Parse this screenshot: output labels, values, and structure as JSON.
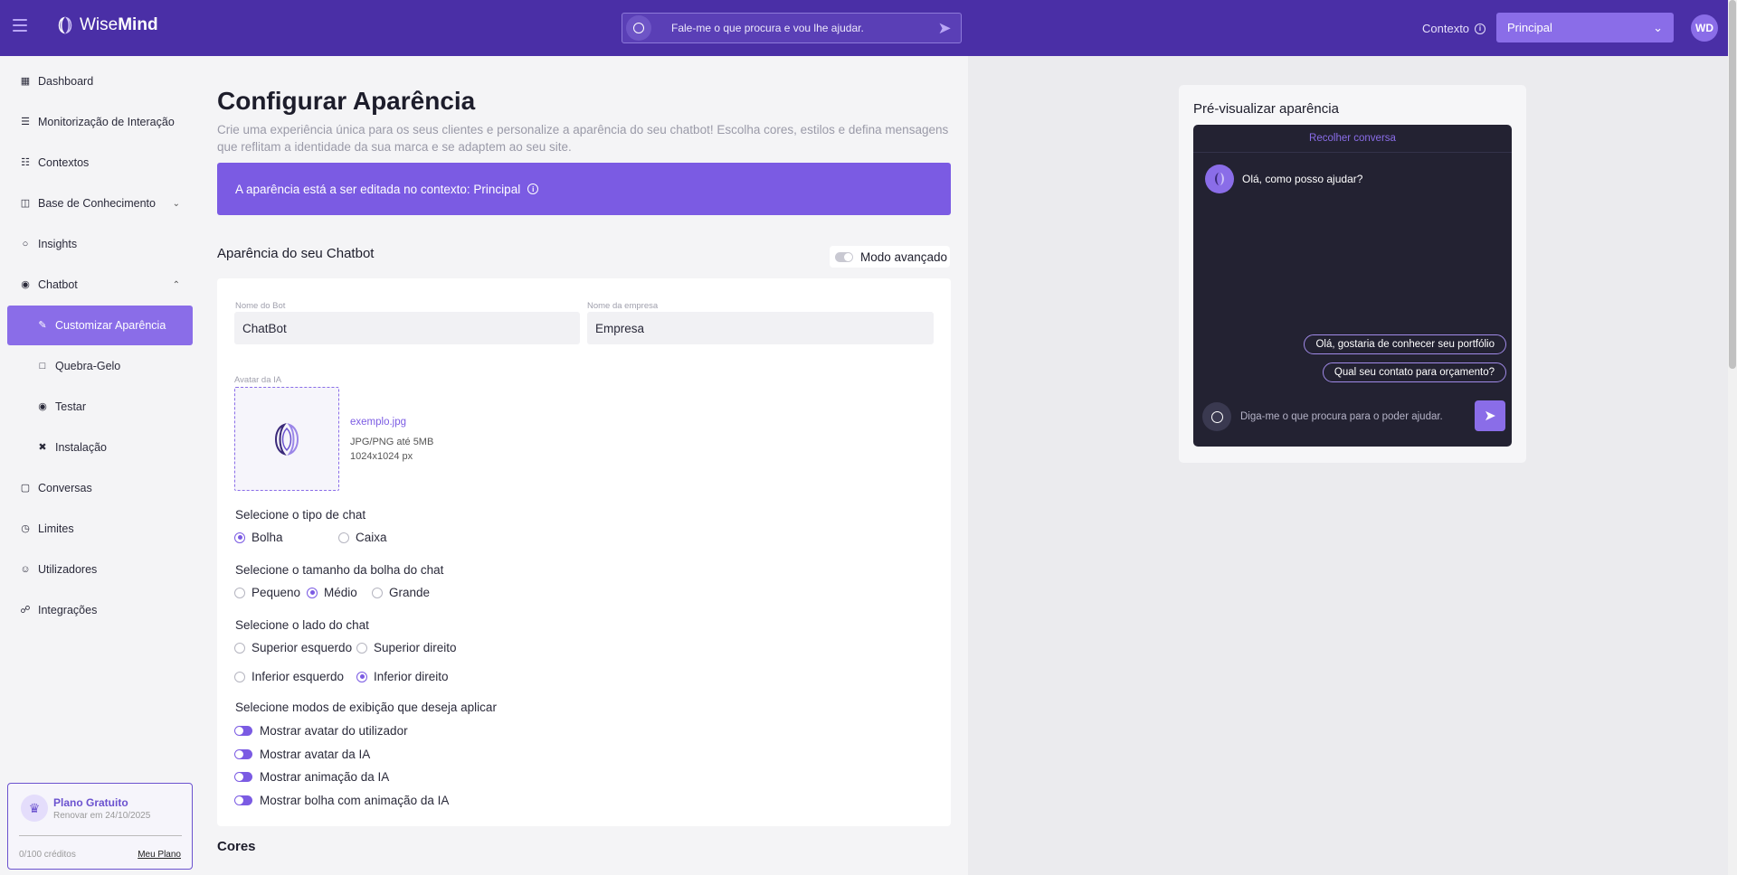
{
  "header": {
    "logo_wise": "Wise",
    "logo_mind": "Mind",
    "search_placeholder": "Fale-me o que procura e vou lhe ajudar.",
    "context_label": "Contexto",
    "context_value": "Principal",
    "user_initials": "WD"
  },
  "sidebar": {
    "items": [
      {
        "label": "Dashboard",
        "icon": "dashboard-icon"
      },
      {
        "label": "Monitorização de Interação",
        "icon": "monitor-icon"
      },
      {
        "label": "Contextos",
        "icon": "contexts-icon"
      },
      {
        "label": "Base de Conhecimento",
        "icon": "knowledge-icon"
      },
      {
        "label": "Insights",
        "icon": "lightbulb-icon"
      },
      {
        "label": "Chatbot",
        "icon": "chatbot-icon"
      },
      {
        "label": "Customizar Aparência",
        "icon": "edit-icon"
      },
      {
        "label": "Quebra-Gelo",
        "icon": "chat-bubble-icon"
      },
      {
        "label": "Testar",
        "icon": "eye-icon"
      },
      {
        "label": "Instalação",
        "icon": "tools-icon"
      },
      {
        "label": "Conversas",
        "icon": "conversations-icon"
      },
      {
        "label": "Limites",
        "icon": "timer-icon"
      },
      {
        "label": "Utilizadores",
        "icon": "user-icon"
      },
      {
        "label": "Integrações",
        "icon": "integrations-icon"
      }
    ],
    "plan": {
      "title": "Plano Gratuito",
      "renew": "Renovar em 24/10/2025",
      "credits": "0/100 créditos",
      "link": "Meu Plano"
    }
  },
  "main": {
    "title": "Configurar Aparência",
    "description": "Crie uma experiência única para os seus clientes e personalize a aparência do seu chatbot! Escolha cores, estilos e defina mensagens que reflitam a identidade da sua marca e se adaptem ao seu site.",
    "banner": "A aparência está a ser editada no contexto: Principal",
    "section_title": "Aparência do seu Chatbot",
    "advanced_mode": "Modo avançado",
    "bot_name_label": "Nome do Bot",
    "bot_name_value": "ChatBot",
    "company_label": "Nome da empresa",
    "company_value": "Empresa",
    "avatar_label": "Avatar da IA",
    "file_name": "exemplo.jpg",
    "file_types": "JPG/PNG até 5MB",
    "file_dims": "1024x1024 px",
    "chat_type_title": "Selecione o tipo de chat",
    "chat_type_options": [
      "Bolha",
      "Caixa"
    ],
    "bubble_size_title": "Selecione o tamanho da bolha do chat",
    "bubble_size_options": [
      "Pequeno",
      "Médio",
      "Grande"
    ],
    "side_title": "Selecione o lado do chat",
    "side_options": [
      "Superior esquerdo",
      "Superior direito",
      "Inferior esquerdo",
      "Inferior direito"
    ],
    "display_title": "Selecione modos de exibição que deseja aplicar",
    "display_options": [
      "Mostrar avatar do utilizador",
      "Mostrar avatar da IA",
      "Mostrar animação da IA",
      "Mostrar bolha com animação da IA"
    ],
    "colors_title": "Cores"
  },
  "preview": {
    "title": "Pré-visualizar aparência",
    "collapse": "Recolher conversa",
    "bot_message": "Olá, como posso ajudar?",
    "chips": [
      "Olá, gostaria de conhecer seu portfólio",
      "Qual seu contato para orçamento?"
    ],
    "input_placeholder": "Diga-me o que procura para o poder ajudar."
  },
  "colors": {
    "header": "#4a2fa6",
    "accent": "#7b5be3",
    "chat_bg": "#232232"
  }
}
